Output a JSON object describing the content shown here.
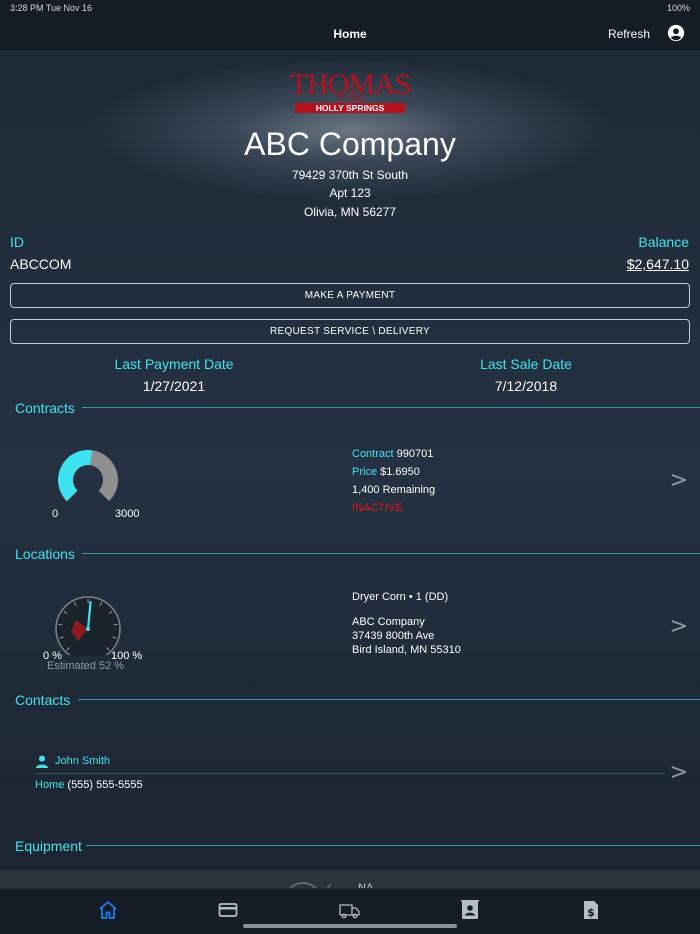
{
  "status_bar": {
    "time": "3:28 PM  Tue Nov 16",
    "battery": "100%"
  },
  "nav": {
    "title": "Home",
    "refresh_label": "Refresh"
  },
  "brand": {
    "logo_text_top": "THOMAS",
    "logo_text_mid": "LP GAS",
    "logo_text_bottom": "HOLLY SPRINGS"
  },
  "company": {
    "name": "ABC Company",
    "address_line1": "79429 370th St South",
    "address_line2": "Apt 123",
    "address_line3": "Olivia, MN 56277"
  },
  "account": {
    "id_label": "ID",
    "id_value": "ABCCOM",
    "balance_label": "Balance",
    "balance_value": "$2,647.10"
  },
  "buttons": {
    "make_payment": "MAKE A PAYMENT",
    "request_service": "REQUEST SERVICE \\ DELIVERY"
  },
  "dates": {
    "last_payment_label": "Last Payment Date",
    "last_payment_value": "1/27/2021",
    "last_sale_label": "Last Sale Date",
    "last_sale_value": "7/12/2018"
  },
  "contracts": {
    "header": "Contracts",
    "gauge_min": "0",
    "gauge_max": "3000",
    "gauge_fraction": 0.53,
    "contract_label": "Contract",
    "contract_value": "990701",
    "price_label": "Price",
    "price_value": "$1.6950",
    "remaining": "1,400 Remaining",
    "status": "INACTIVE"
  },
  "locations": {
    "header": "Locations",
    "tank_min": "0 %",
    "tank_max": "100 %",
    "estimated": "Estimated 52 %",
    "estimated_percent": 52,
    "product": "Dryer Corn • 1 (DD)",
    "site_name": "ABC Company",
    "site_address1": "37439 800th Ave",
    "site_address2": "Bird Island, MN  55310"
  },
  "contacts": {
    "header": "Contacts",
    "name": "John Smith",
    "phone_label": "Home",
    "phone_value": "(555) 555-5555"
  },
  "equipment": {
    "header": "Equipment",
    "partial_text": "NA"
  },
  "colors": {
    "accent": "#3de3ee",
    "inactive": "#e0141a",
    "tab_active": "#1e7bf0",
    "tab_inactive": "#b6bdc6"
  },
  "tabs": [
    "home-icon",
    "credit-card-icon",
    "truck-icon",
    "contact-book-icon",
    "invoice-icon"
  ]
}
